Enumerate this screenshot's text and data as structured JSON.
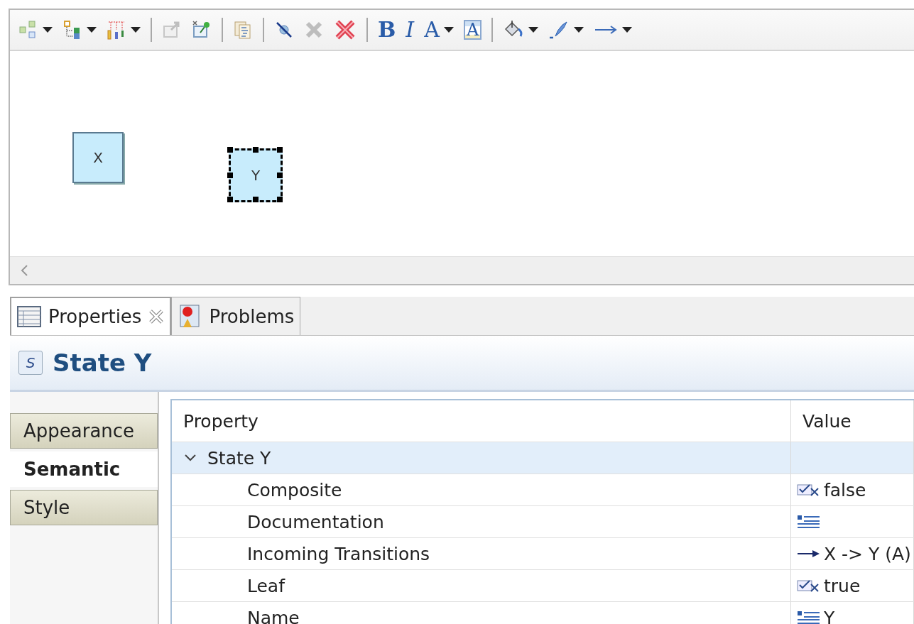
{
  "toolbar": [
    {
      "kind": "shapes",
      "dropdown": true,
      "disabled": false
    },
    {
      "kind": "tree-layout",
      "dropdown": true,
      "disabled": false
    },
    {
      "kind": "distribute",
      "dropdown": true,
      "disabled": false
    },
    {
      "kind": "separator"
    },
    {
      "kind": "export",
      "dropdown": false,
      "disabled": true
    },
    {
      "kind": "pin",
      "dropdown": false,
      "disabled": false
    },
    {
      "kind": "separator"
    },
    {
      "kind": "copy",
      "dropdown": false,
      "disabled": false
    },
    {
      "kind": "separator"
    },
    {
      "kind": "hide",
      "dropdown": false,
      "disabled": false
    },
    {
      "kind": "delete",
      "dropdown": false,
      "disabled": true
    },
    {
      "kind": "delete-model",
      "dropdown": false,
      "disabled": false
    },
    {
      "kind": "separator"
    },
    {
      "kind": "bold",
      "glyph": "B",
      "dropdown": false,
      "disabled": false
    },
    {
      "kind": "italic",
      "glyph": "I",
      "dropdown": false,
      "disabled": false
    },
    {
      "kind": "font-color",
      "glyph": "A",
      "dropdown": true,
      "disabled": false
    },
    {
      "kind": "text-box",
      "glyph": "A",
      "dropdown": false,
      "disabled": false
    },
    {
      "kind": "separator"
    },
    {
      "kind": "fill",
      "dropdown": true,
      "disabled": false
    },
    {
      "kind": "brush",
      "dropdown": true,
      "disabled": false
    },
    {
      "kind": "arrow",
      "dropdown": true,
      "disabled": false
    }
  ],
  "diagram": {
    "nodes": [
      {
        "label": "X",
        "selected": false
      },
      {
        "label": "Y",
        "selected": true
      }
    ]
  },
  "tabs": [
    {
      "label": "Properties",
      "selected": true,
      "closable": true,
      "kind": "properties"
    },
    {
      "label": "Problems",
      "selected": false,
      "closable": false,
      "kind": "problems"
    }
  ],
  "properties": {
    "icon_letter": "S",
    "title": "State Y",
    "sections": [
      {
        "label": "Appearance",
        "selected": false
      },
      {
        "label": "Semantic",
        "selected": true
      },
      {
        "label": "Style",
        "selected": false
      }
    ],
    "table": {
      "columns": [
        "Property",
        "Value"
      ],
      "group": {
        "label": "State Y",
        "expanded": true
      },
      "rows": [
        {
          "property": "Composite",
          "kind": "boolean",
          "value": "false"
        },
        {
          "property": "Documentation",
          "kind": "text"
        },
        {
          "property": "Incoming Transitions",
          "kind": "reference",
          "value": "X -> Y (A)"
        },
        {
          "property": "Leaf",
          "kind": "boolean",
          "value": "true"
        },
        {
          "property": "Name",
          "kind": "text",
          "value": "Y"
        }
      ]
    }
  }
}
